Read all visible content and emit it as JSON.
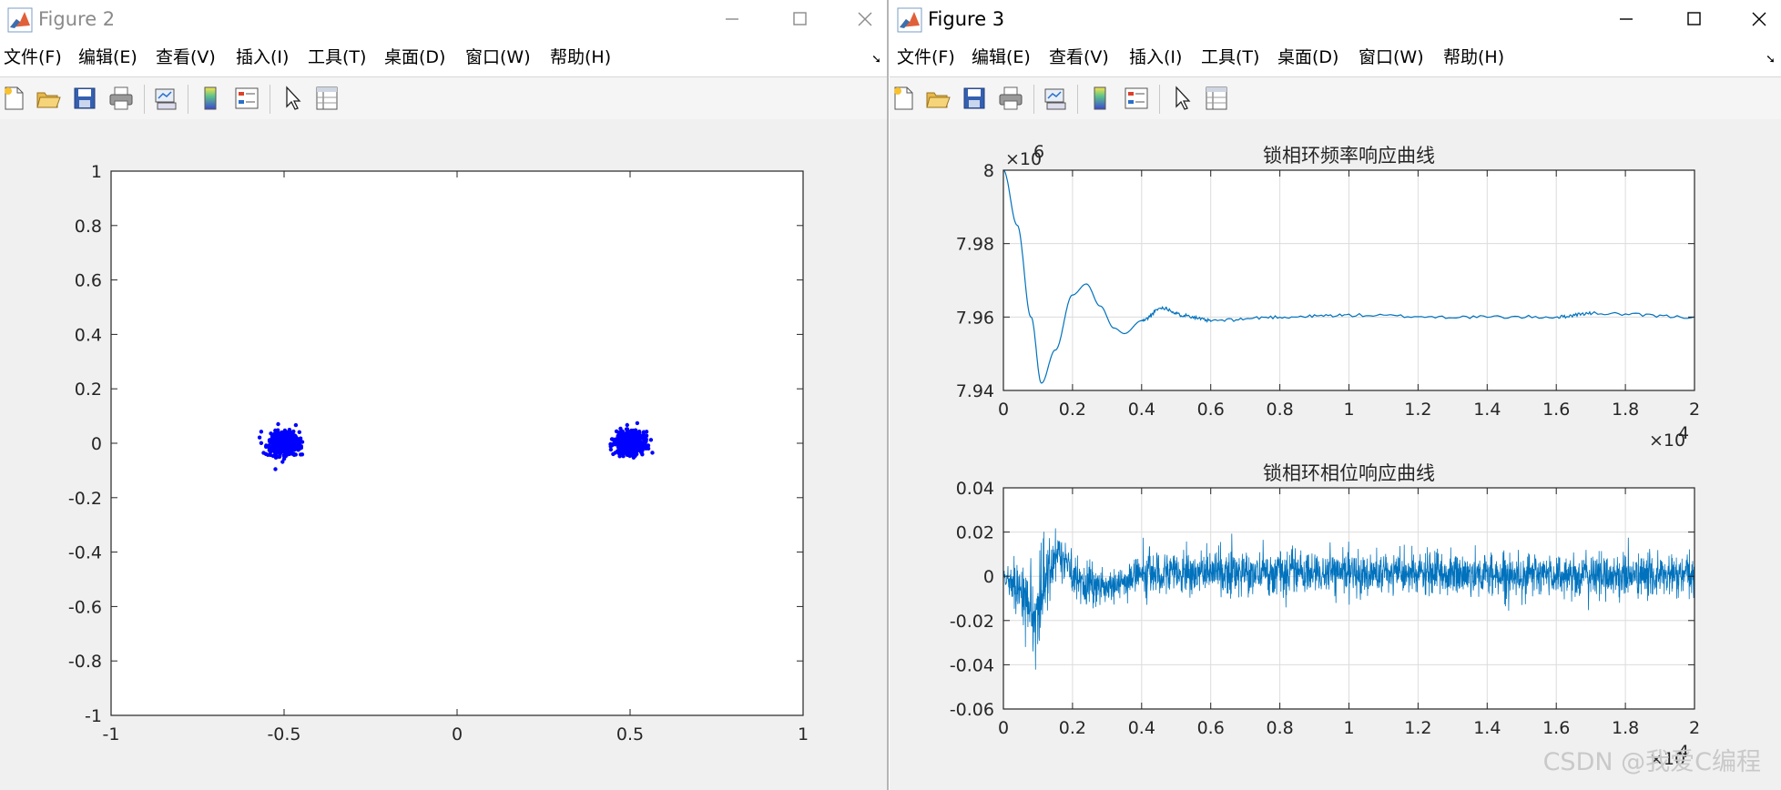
{
  "windows": {
    "left": {
      "title": "Figure 2"
    },
    "right": {
      "title": "Figure 3"
    }
  },
  "menu": [
    {
      "label": "文件(F)"
    },
    {
      "label": "编辑(E)"
    },
    {
      "label": "查看(V)"
    },
    {
      "label": "插入(I)"
    },
    {
      "label": "工具(T)"
    },
    {
      "label": "桌面(D)"
    },
    {
      "label": "窗口(W)"
    },
    {
      "label": "帮助(H)"
    }
  ],
  "toolbar_icons": [
    "new-figure-icon",
    "open-file-icon",
    "save-icon",
    "print-icon",
    "link-plot-icon",
    "insert-colorbar-icon",
    "insert-legend-icon",
    "edit-plot-arrow-icon",
    "property-inspector-icon"
  ],
  "colors": {
    "scatter": "#0000ff",
    "line": "#0072bd",
    "grid": "#dcdcdc"
  },
  "watermark": "CSDN @我爱C编程",
  "chart_data": [
    {
      "type": "scatter",
      "title": "",
      "xlim": [
        -1,
        1
      ],
      "ylim": [
        -1,
        1
      ],
      "xticks": [
        "-1",
        "-0.5",
        "0",
        "0.5",
        "1"
      ],
      "yticks": [
        "1",
        "0.8",
        "0.6",
        "0.4",
        "0.2",
        "0",
        "-0.2",
        "-0.4",
        "-0.6",
        "-0.8",
        "-1"
      ],
      "grid": false,
      "clusters": [
        {
          "center": [
            -0.5,
            0.0
          ],
          "spread": 0.045
        },
        {
          "center": [
            0.5,
            0.0
          ],
          "spread": 0.045
        }
      ]
    },
    {
      "type": "line",
      "title": "锁相环频率响应曲线",
      "xlim": [
        0,
        20000
      ],
      "ylim": [
        7940000,
        8000000
      ],
      "x_exponent": "×10",
      "x_exponent_power": "4",
      "y_exponent": "×10",
      "y_exponent_power": "6",
      "xticks": [
        "0",
        "0.2",
        "0.4",
        "0.6",
        "0.8",
        "1",
        "1.2",
        "1.4",
        "1.6",
        "1.8",
        "2"
      ],
      "yticks": [
        "8",
        "7.98",
        "7.96",
        "7.94"
      ],
      "grid": true,
      "x": [
        0,
        400,
        800,
        1100,
        1500,
        2000,
        2400,
        2800,
        3200,
        3500,
        4000,
        4600,
        5200,
        6000,
        8000,
        10000,
        13000,
        16000,
        17000,
        20000
      ],
      "y": [
        8000000,
        7985000,
        7960000,
        7942000,
        7951000,
        7966000,
        7969000,
        7963000,
        7957000,
        7955500,
        7959000,
        7962500,
        7960500,
        7959000,
        7960000,
        7960500,
        7960000,
        7960000,
        7961000,
        7960000
      ]
    },
    {
      "type": "line",
      "title": "锁相环相位响应曲线",
      "xlim": [
        0,
        20000
      ],
      "ylim": [
        -0.06,
        0.04
      ],
      "x_exponent": "×10",
      "x_exponent_power": "4",
      "xticks": [
        "0",
        "0.2",
        "0.4",
        "0.6",
        "0.8",
        "1",
        "1.2",
        "1.4",
        "1.6",
        "1.8",
        "2"
      ],
      "yticks": [
        "0.04",
        "0.02",
        "0",
        "-0.02",
        "-0.04",
        "-0.06"
      ],
      "grid": true,
      "envelope": [
        {
          "x": 0,
          "mean": 0.0,
          "amp": 0.003
        },
        {
          "x": 500,
          "mean": -0.005,
          "amp": 0.02
        },
        {
          "x": 900,
          "mean": -0.02,
          "amp": 0.03
        },
        {
          "x": 1500,
          "mean": 0.012,
          "amp": 0.015
        },
        {
          "x": 2200,
          "mean": -0.002,
          "amp": 0.015
        },
        {
          "x": 3000,
          "mean": -0.006,
          "amp": 0.008
        },
        {
          "x": 4000,
          "mean": 0.002,
          "amp": 0.012
        },
        {
          "x": 20000,
          "mean": 0.0,
          "amp": 0.013
        }
      ]
    }
  ]
}
